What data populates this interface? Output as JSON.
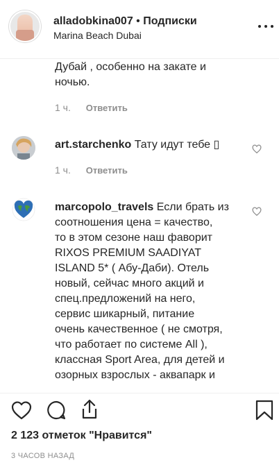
{
  "header": {
    "username": "alladobkina007",
    "separator": "•",
    "follow_label": "Подписки",
    "location": "Marina Beach Dubai"
  },
  "comments": [
    {
      "username": "",
      "text_lines": [
        "Дубай , особенно на закате и",
        "ночью."
      ],
      "time": "1 ч.",
      "reply_label": "Ответить"
    },
    {
      "username": "art.starchenko",
      "text": "Тату идут тебе ▯",
      "time": "1 ч.",
      "reply_label": "Ответить"
    },
    {
      "username": "marcopolo_travels",
      "first_line_text": "Если брать из",
      "text_lines": [
        "соотношения цена = качество,",
        "то в этом сезоне наш фаворит",
        "RIXOS PREMIUM SAADIYAT",
        "ISLAND 5* ( Абу-Даби). Отель",
        "новый, сейчас много акций и",
        "спец.предложений на него,",
        "сервис шикарный, питание",
        "очень качественное ( не смотря,",
        "что работает по системе All ),",
        "классная Sport Area, для детей и",
        "озорных взрослых - аквапарк и"
      ]
    }
  ],
  "footer": {
    "likes": "2 123 отметок \"Нравится\"",
    "timestamp": "3 ЧАСОВ НАЗАД"
  },
  "icons": {
    "like": "heart-icon",
    "comment": "comment-icon",
    "share": "share-icon",
    "save": "bookmark-icon",
    "more": "more-options-icon"
  }
}
